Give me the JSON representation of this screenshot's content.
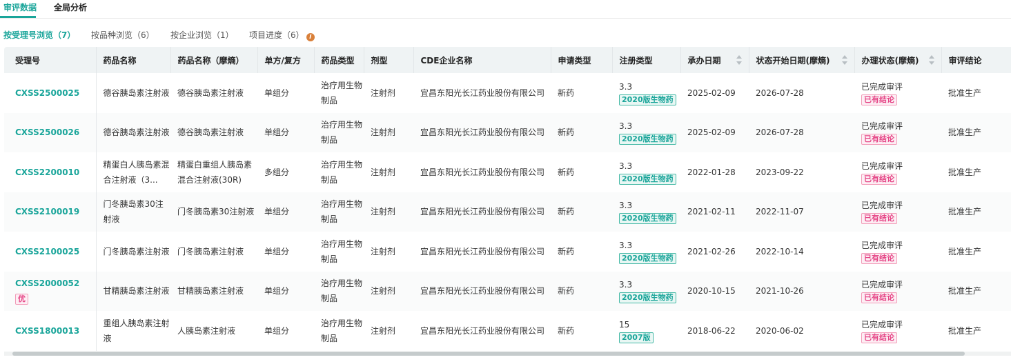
{
  "top_tabs": [
    {
      "label": "审评数据",
      "active": true
    },
    {
      "label": "全局分析",
      "active": false
    }
  ],
  "sub_tabs": [
    {
      "label": "按受理号浏览（7）",
      "active": true
    },
    {
      "label": "按品种浏览（6）",
      "active": false
    },
    {
      "label": "按企业浏览（1）",
      "active": false
    },
    {
      "label": "项目进度（6）",
      "active": false
    }
  ],
  "table": {
    "headers": [
      "受理号",
      "药品名称",
      "药品名称（摩熵）",
      "单方/复方",
      "药品类型",
      "剂型",
      "CDE企业名称",
      "申请类型",
      "注册类型",
      "承办日期",
      "状态开始日期(摩熵)",
      "办理状态(摩熵)",
      "审评结论"
    ],
    "rows": [
      {
        "accept_no": "CXSS2500025",
        "priority": "",
        "drug_name": "德谷胰岛素注射液",
        "drug_name_ms": "德谷胰岛素注射液",
        "compound": "单组分",
        "drug_type": "治疗用生物制品",
        "dosage_form": "注射剂",
        "company": "宜昌东阳光长江药业股份有限公司",
        "apply_type": "新药",
        "reg_type": "3.3",
        "reg_badge": "2020版生物药",
        "undertake_date": "2025-02-09",
        "status_date": "2026-07-28",
        "status": "已完成审评",
        "status_badge": "已有结论",
        "conclusion": "批准生产"
      },
      {
        "accept_no": "CXSS2500026",
        "priority": "",
        "drug_name": "德谷胰岛素注射液",
        "drug_name_ms": "德谷胰岛素注射液",
        "compound": "单组分",
        "drug_type": "治疗用生物制品",
        "dosage_form": "注射剂",
        "company": "宜昌东阳光长江药业股份有限公司",
        "apply_type": "新药",
        "reg_type": "3.3",
        "reg_badge": "2020版生物药",
        "undertake_date": "2025-02-09",
        "status_date": "2026-07-28",
        "status": "已完成审评",
        "status_badge": "已有结论",
        "conclusion": "批准生产"
      },
      {
        "accept_no": "CXSS2200010",
        "priority": "",
        "drug_name": "精蛋白人胰岛素混合注射液（3...",
        "drug_name_ms": "精蛋白重组人胰岛素混合注射液(30R)",
        "compound": "多组分",
        "drug_type": "治疗用生物制品",
        "dosage_form": "注射剂",
        "company": "宜昌东阳光长江药业股份有限公司",
        "apply_type": "新药",
        "reg_type": "3.3",
        "reg_badge": "2020版生物药",
        "undertake_date": "2022-01-28",
        "status_date": "2023-09-22",
        "status": "已完成审评",
        "status_badge": "已有结论",
        "conclusion": "批准生产"
      },
      {
        "accept_no": "CXSS2100019",
        "priority": "",
        "drug_name": "门冬胰岛素30注射液",
        "drug_name_ms": "门冬胰岛素30注射液",
        "compound": "单组分",
        "drug_type": "治疗用生物制品",
        "dosage_form": "注射剂",
        "company": "宜昌东阳光长江药业股份有限公司",
        "apply_type": "新药",
        "reg_type": "3.3",
        "reg_badge": "2020版生物药",
        "undertake_date": "2021-02-11",
        "status_date": "2022-11-07",
        "status": "已完成审评",
        "status_badge": "已有结论",
        "conclusion": "批准生产"
      },
      {
        "accept_no": "CXSS2100025",
        "priority": "",
        "drug_name": "门冬胰岛素注射液",
        "drug_name_ms": "门冬胰岛素注射液",
        "compound": "单组分",
        "drug_type": "治疗用生物制品",
        "dosage_form": "注射剂",
        "company": "宜昌东阳光长江药业股份有限公司",
        "apply_type": "新药",
        "reg_type": "3.3",
        "reg_badge": "2020版生物药",
        "undertake_date": "2021-02-26",
        "status_date": "2022-10-14",
        "status": "已完成审评",
        "status_badge": "已有结论",
        "conclusion": "批准生产"
      },
      {
        "accept_no": "CXSS2000052",
        "priority": "优",
        "drug_name": "甘精胰岛素注射液",
        "drug_name_ms": "甘精胰岛素注射液",
        "compound": "单组分",
        "drug_type": "治疗用生物制品",
        "dosage_form": "注射剂",
        "company": "宜昌东阳光长江药业股份有限公司",
        "apply_type": "新药",
        "reg_type": "3.3",
        "reg_badge": "2020版生物药",
        "undertake_date": "2020-10-15",
        "status_date": "2021-10-26",
        "status": "已完成审评",
        "status_badge": "已有结论",
        "conclusion": "批准生产"
      },
      {
        "accept_no": "CXSS1800013",
        "priority": "",
        "drug_name": "重组人胰岛素注射液",
        "drug_name_ms": "人胰岛素注射液",
        "compound": "单组分",
        "drug_type": "治疗用生物制品",
        "dosage_form": "注射剂",
        "company": "宜昌东阳光长江药业股份有限公司",
        "apply_type": "新药",
        "reg_type": "15",
        "reg_badge": "2007版",
        "undertake_date": "2018-06-22",
        "status_date": "2020-06-02",
        "status": "已完成审评",
        "status_badge": "已有结论",
        "conclusion": "批准生产"
      }
    ]
  },
  "colors": {
    "accent": "#1aa59a",
    "header_bg": "#eff3f4",
    "pink": "#e54686",
    "info_icon": "#d9803a"
  }
}
